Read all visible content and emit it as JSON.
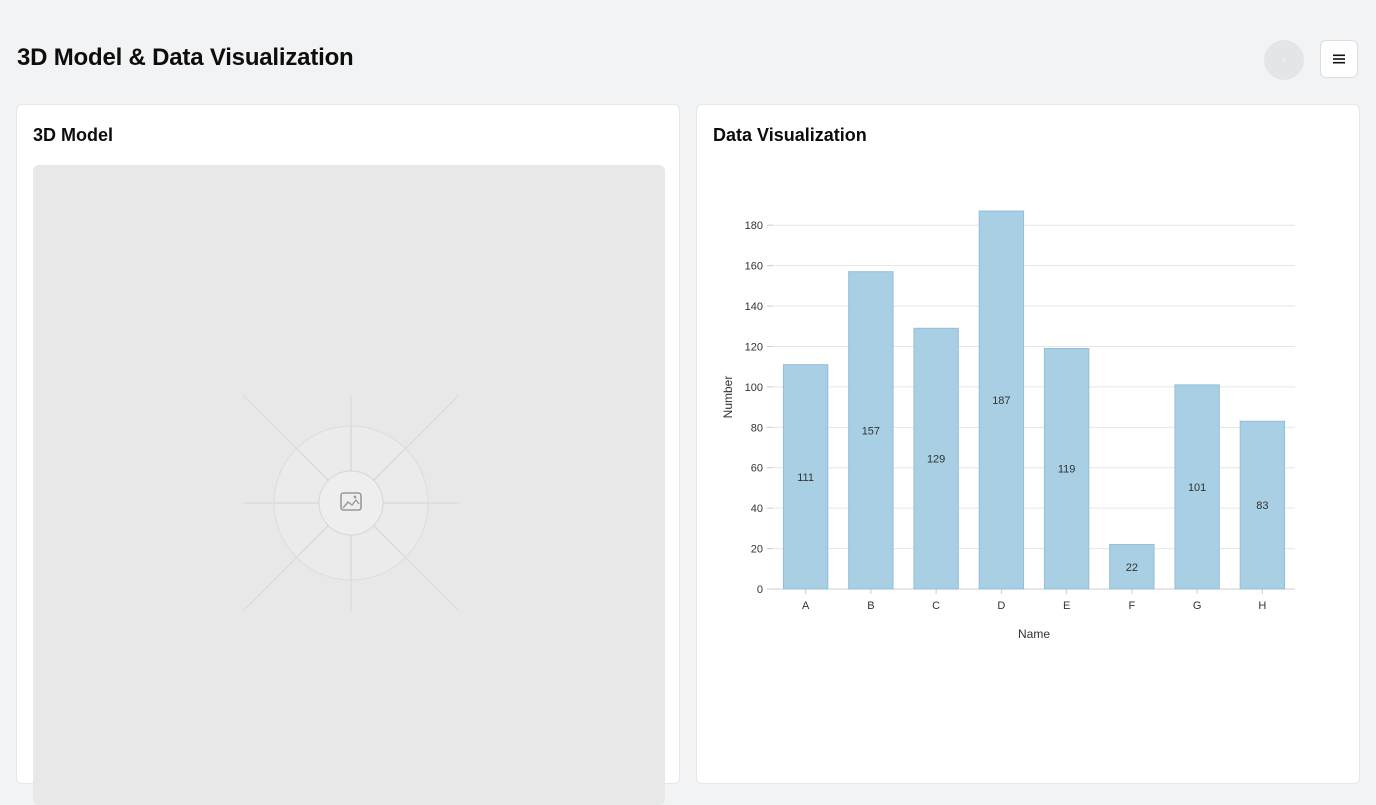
{
  "header": {
    "title": "3D Model & Data Visualization"
  },
  "model_card": {
    "title": "3D Model",
    "placeholder_icon": "image-icon"
  },
  "chart_card": {
    "title": "Data Visualization"
  },
  "colors": {
    "bar_fill": "#a8cfe3",
    "bar_stroke": "#93bfd6",
    "grid": "#e6e6e6",
    "axis": "#cccccc",
    "text": "#333333",
    "background": "#f2f3f5",
    "viewport": "#e8e8e8"
  },
  "chart_data": {
    "type": "bar",
    "categories": [
      "A",
      "B",
      "C",
      "D",
      "E",
      "F",
      "G",
      "H"
    ],
    "values": [
      111,
      157,
      129,
      187,
      119,
      22,
      101,
      83
    ],
    "xlabel": "Name",
    "ylabel": "Number",
    "ylim": [
      0,
      190
    ],
    "yticks": [
      0,
      20,
      40,
      60,
      80,
      100,
      120,
      140,
      160,
      180
    ],
    "grid": true,
    "data_labels": true
  }
}
